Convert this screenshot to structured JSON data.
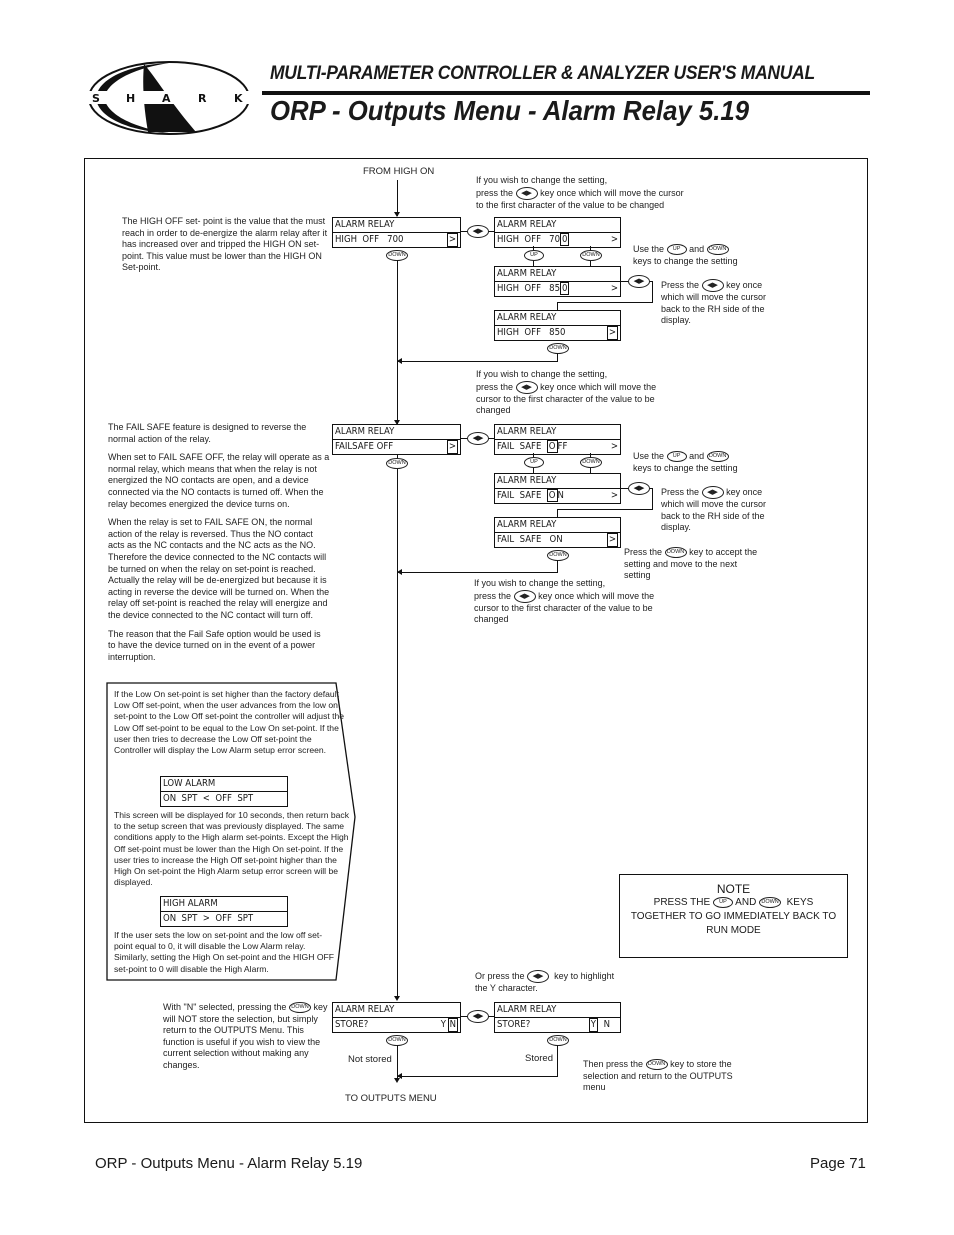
{
  "header": {
    "logo_text": "SHARK",
    "manual_title": "MULTI-PARAMETER CONTROLLER & ANALYZER USER'S MANUAL",
    "page_title": "ORP - Outputs Menu - Alarm Relay 5.19"
  },
  "keys": {
    "down": "DOWN",
    "up": "UP",
    "left_right": "◀▶"
  },
  "flow": {
    "from_label": "FROM HIGH ON",
    "to_label": "TO OUTPUTS MENU",
    "not_stored": "Not stored",
    "stored": "Stored"
  },
  "high_off": {
    "description": "The HIGH OFF set- point is the value that the must reach in order to de-energize the alarm relay after it has increased over and tripped the HIGH ON set-point. This value must be lower than the HIGH ON Set-point.",
    "change_hint_1": "If you wish to change the setting,",
    "change_hint_2a": "press the",
    "change_hint_2b": "key once which will move the cursor",
    "change_hint_3": "to the first character of the value to be changed",
    "use_keys_a": "Use the",
    "use_keys_b": "and",
    "use_keys_c": "keys to change the setting",
    "press_lr_a": "Press the",
    "press_lr_b": "key once",
    "press_lr_c": "which will move the cursor",
    "press_lr_d": "back to the RH side of the",
    "press_lr_e": "display.",
    "screens": [
      {
        "line1": "ALARM RELAY",
        "line2": "HIGH  OFF   700",
        "cursor": "",
        "suffix": "",
        "gt": ">"
      },
      {
        "line1": "ALARM RELAY",
        "line2": "HIGH  OFF   70",
        "cursor": "0",
        "suffix": "",
        "gt": ">"
      },
      {
        "line1": "ALARM RELAY",
        "line2": "HIGH  OFF   85",
        "cursor": "0",
        "suffix": "",
        "gt": ">"
      },
      {
        "line1": "ALARM RELAY",
        "line2": "HIGH  OFF   850",
        "cursor": "",
        "suffix": "",
        "gt": ">"
      }
    ]
  },
  "fail_safe": {
    "paragraphs": [
      "The FAIL SAFE feature is designed to reverse the normal action of the relay.",
      "When set to FAIL SAFE OFF, the relay will operate as a normal relay, which means that when the relay is not energized the NO contacts are open, and a device connected via the NO contacts is turned off. When the relay becomes energized the device turns on.",
      "When the relay is set to FAIL SAFE ON, the normal action of the relay is reversed. Thus the NO contact acts as the NC contacts and the NC acts as the NO. Therefore the device connected to the NC contacts will be turned on when the relay on set-point is reached. Actually the relay will be de-energized but because it is acting in reverse the device will be turned on. When the relay off set-point is reached the relay will energize and the device connected to the NC contact will turn off.",
      "The reason that the Fail Safe option would be used is to have the device turned on in the event of a power interruption."
    ],
    "change_hint_1": "If you wish to change the setting,",
    "change_hint_2a": "press the",
    "change_hint_2b": "key once which will move the",
    "change_hint_3": "cursor to the first character of the value to be",
    "change_hint_4": "changed",
    "use_keys_a": "Use the",
    "use_keys_b": "and",
    "use_keys_c": "keys to change the setting",
    "press_lr_a": "Press the",
    "press_lr_b": "key once",
    "press_lr_c": "which will move the cursor",
    "press_lr_d": "back to the RH side of the",
    "press_lr_e": "display.",
    "accept_a": "Press the",
    "accept_b": "key to accept the",
    "accept_c": "setting and move to the next",
    "accept_d": "setting",
    "screens": [
      {
        "line1": "ALARM RELAY",
        "line2": "FAILSAFE OFF",
        "gt": ">"
      },
      {
        "line1": "ALARM RELAY",
        "line2_pre": "FAIL  SAFE  ",
        "cursor": "O",
        "line2_post": "FF",
        "gt": ">"
      },
      {
        "line1": "ALARM RELAY",
        "line2_pre": "FAIL  SAFE  ",
        "cursor": "O",
        "line2_post": "N",
        "gt": ">"
      },
      {
        "line1": "ALARM RELAY",
        "line2": "FAIL  SAFE   ON",
        "gt": ">"
      }
    ]
  },
  "store_hint": {
    "change_hint_1": "If you wish to change the setting,",
    "change_hint_2a": "press the",
    "change_hint_2b": "key once which will move the",
    "change_hint_3": "cursor to the first character of the value to be",
    "change_hint_4": "changed"
  },
  "alarm_callout": {
    "p1": "If the Low On set-point is set higher than the factory default Low Off set-point, when the user advances from the low on set-point to the Low Off set-point the controller will adjust the Low Off set-point to be equal to the Low On set-point. If the user then tries to decrease the Low Off set-point the Controller will display the Low Alarm setup error screen.",
    "low_screen": {
      "line1": "LOW ALARM",
      "line2": "ON  SPT  <  OFF  SPT"
    },
    "p2": "This screen will be displayed for 10 seconds, then return back to the setup screen that was previously displayed. The same conditions apply to the High alarm set-points. Except the High Off set-point must be lower than the High On set-point. If the user tries to increase the High Off set-point higher than the High On set-point the High Alarm setup error screen will be displayed.",
    "high_screen": {
      "line1": "HIGH ALARM",
      "line2": "ON  SPT  >  OFF  SPT"
    },
    "p3": "If the user sets the low on set-point and the low off set-point equal to 0, it will disable the Low Alarm relay. Similarly, setting the High On set-point and the HIGH OFF set-point to 0 will disable the High Alarm."
  },
  "note": {
    "title": "NOTE",
    "line1a": "PRESS THE",
    "line1b": "AND",
    "line1c": "KEYS",
    "line2": "TOGETHER TO GO IMMEDIATELY BACK TO",
    "line3": "RUN MODE"
  },
  "store": {
    "highlight_a": "Or press the",
    "highlight_b": "key to highlight",
    "highlight_c": "the Y character.",
    "n_note_a": "With \"N\" selected, pressing the",
    "n_note_b": "key will NOT store the selection, but simply return to the OUTPUTS Menu. This function is useful if you wish to view the current selection without making any changes.",
    "then_a": "Then press the",
    "then_b": "key to store the",
    "then_c": "selection and return to the OUTPUTS",
    "then_d": "menu",
    "screens": [
      {
        "line1": "ALARM RELAY",
        "line2": "STORE?",
        "y": "Y",
        "n": "N",
        "selected": "N"
      },
      {
        "line1": "ALARM RELAY",
        "line2": "STORE?",
        "y": "Y",
        "n": "N",
        "selected": "Y"
      }
    ]
  },
  "footer": {
    "section": "ORP - Outputs Menu - Alarm Relay 5.19",
    "page": "Page 71"
  }
}
